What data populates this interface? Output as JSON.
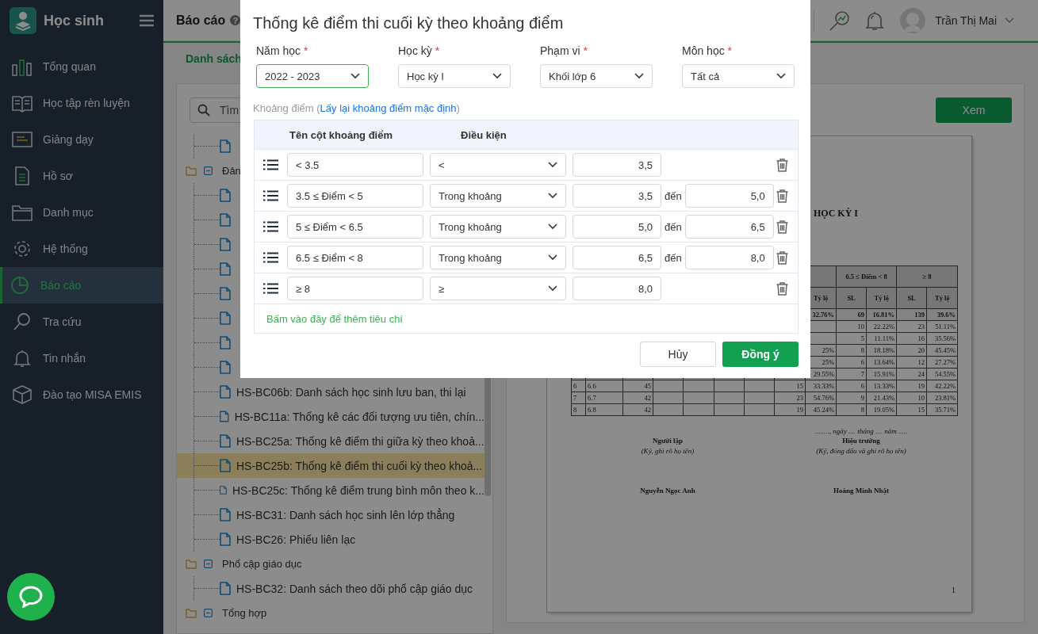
{
  "app": {
    "title": "Học sinh"
  },
  "sidebar": {
    "items": [
      {
        "label": "Tổng quan",
        "selected": false
      },
      {
        "label": "Học tập rèn luyện",
        "selected": false
      },
      {
        "label": "Giảng dạy",
        "selected": false
      },
      {
        "label": "Hồ sơ",
        "selected": false
      },
      {
        "label": "Danh mục",
        "selected": false
      },
      {
        "label": "Hệ thống",
        "selected": false
      },
      {
        "label": "Báo cáo",
        "selected": true
      },
      {
        "label": "Tra cứu",
        "selected": false
      },
      {
        "label": "Tin nhắn",
        "selected": false
      },
      {
        "label": "Đào tạo MISA EMIS",
        "selected": false
      }
    ]
  },
  "topbar": {
    "title": "Báo cáo",
    "help_glyph": "?",
    "user_name": "Trần Thị Mai"
  },
  "tabs": [
    {
      "label": "Danh sách",
      "selected": true
    }
  ],
  "report_tree": {
    "search": {
      "placeholder": "Tìm"
    },
    "nodes": [
      {
        "kind": "item",
        "selected": false
      },
      {
        "kind": "group",
        "label": "Đản",
        "expanded": true,
        "children": [
          {
            "kind": "item",
            "selected": false
          },
          {
            "kind": "item",
            "selected": false
          },
          {
            "kind": "item",
            "selected": false
          },
          {
            "kind": "item",
            "selected": false
          },
          {
            "kind": "item",
            "selected": false
          },
          {
            "kind": "item",
            "selected": false
          },
          {
            "kind": "item",
            "selected": false
          },
          {
            "kind": "item",
            "selected": false
          },
          {
            "kind": "item",
            "label": "HS-BC06b: Danh sách học sinh lưu ban, thi lại",
            "selected": false
          },
          {
            "kind": "item",
            "label": "HS-BC11a: Thống kê các đối tượng ưu tiên, chín...",
            "selected": false
          },
          {
            "kind": "item",
            "label": "HS-BC25a: Thống kê điểm thi giữa kỳ theo khoả...",
            "selected": false
          },
          {
            "kind": "item",
            "label": "HS-BC25b: Thống kê điểm thi cuối kỳ theo khoả...",
            "selected": true
          },
          {
            "kind": "item",
            "label": "HS-BC25c: Thống kê điểm trung bình môn theo k...",
            "selected": false
          },
          {
            "kind": "item",
            "label": "HS-BC31: Danh sách học sinh lên lớp thẳng",
            "selected": false
          },
          {
            "kind": "item",
            "label": "HS-BC26: Phiếu liên lạc",
            "selected": false
          }
        ]
      },
      {
        "kind": "group",
        "label": "Phổ cập giáo dục",
        "expanded": true,
        "children": [
          {
            "kind": "item",
            "label": "HS-BC32: Danh sách theo dõi phổ cập giáo dục",
            "selected": false
          }
        ]
      },
      {
        "kind": "group",
        "label": "Tổng hợp",
        "expanded": true
      }
    ]
  },
  "preview": {
    "view_button": "Xem",
    "document": {
      "title": "HỌC KỲ I",
      "header_groups": [
        "6.5 ≤ Điểm < 8",
        "≥ 8"
      ],
      "subheaders": [
        "Tỷ lệ",
        "SL",
        "Tỷ lệ",
        "SL",
        "Tỷ lệ"
      ],
      "rows": [
        {
          "kind": "total",
          "cells": [
            null,
            null,
            null,
            null,
            null,
            null,
            null,
            null,
            "32.76%",
            "69",
            "16.81%",
            "139",
            "39.6%"
          ]
        },
        {
          "kind": "class",
          "cells": [
            null,
            null,
            null,
            null,
            null,
            null,
            null,
            null,
            null,
            "10",
            "22.22%",
            "23",
            "51.11%"
          ]
        },
        {
          "kind": "class",
          "cells": [
            null,
            null,
            null,
            null,
            null,
            null,
            null,
            null,
            null,
            "5",
            "11.11%",
            "16",
            "35.56%"
          ]
        },
        {
          "kind": "class",
          "cells": [
            null,
            null,
            null,
            null,
            null,
            null,
            null,
            null,
            "25%",
            "8",
            "18.18%",
            "20",
            "45.45%"
          ]
        },
        {
          "kind": "class",
          "cells": [
            null,
            null,
            null,
            null,
            null,
            null,
            null,
            null,
            "25%",
            "6",
            "13.64%",
            "12",
            "27.27%"
          ]
        },
        {
          "kind": "class",
          "cells": [
            null,
            null,
            null,
            null,
            null,
            null,
            null,
            null,
            "29.55%",
            "7",
            "15.91%",
            "24",
            "54.55%"
          ]
        },
        {
          "kind": "class",
          "cells": [
            "6",
            "6.6",
            "45",
            null,
            null,
            null,
            null,
            "15",
            "33.33%",
            "6",
            "13.33%",
            "19",
            "42.22%"
          ]
        },
        {
          "kind": "class",
          "cells": [
            "7",
            "6.7",
            "42",
            null,
            null,
            null,
            null,
            "23",
            "54.76%",
            "9",
            "21.43%",
            "10",
            "23.81%"
          ]
        },
        {
          "kind": "class",
          "cells": [
            "8",
            "6.8",
            "42",
            null,
            null,
            null,
            null,
            "19",
            "45.24%",
            "8",
            "19.05%",
            "15",
            "35.71%"
          ]
        }
      ],
      "signers": [
        {
          "role": "Người lập",
          "hint": "(Ký, ghi rõ họ tên)",
          "name": "Nguyễn Ngọc Anh"
        },
        {
          "date": "........, ngày .... tháng .... năm .....",
          "role": "Hiệu trưởng",
          "hint": "(Ký, đóng dấu và ghi rõ họ tên)",
          "name": "Hoàng Minh Nhật"
        }
      ],
      "page_number": "1"
    }
  },
  "dialog": {
    "title": "Thống kê điểm thi cuối kỳ theo khoảng điểm",
    "filters": [
      {
        "label": "Năm học",
        "required_mark": "*",
        "value": "2022 - 2023",
        "focused": true
      },
      {
        "label": "Học kỳ",
        "required_mark": "*",
        "value": "Học kỳ I",
        "focused": false
      },
      {
        "label": "Phạm vi",
        "required_mark": "*",
        "value": "Khối lớp 6",
        "focused": false
      },
      {
        "label": "Môn học",
        "required_mark": "*",
        "value": "Tất cả",
        "focused": false
      }
    ],
    "range_note": {
      "before": "Khoảng điểm (",
      "link": "Lấy lại khoảng điểm mặc định",
      "after": ")"
    },
    "columns": [
      "Tên cột khoảng điểm",
      "Điều kiện"
    ],
    "ranges": [
      {
        "kind": "single",
        "name": "< 3.5",
        "condition": "<",
        "from": "3,5"
      },
      {
        "kind": "between",
        "name": "3.5 ≤ Điểm < 5",
        "condition": "Trong khoảng",
        "from": "3,5",
        "to_label": "đến",
        "to": "5,0"
      },
      {
        "kind": "between",
        "name": "5 ≤ Điểm < 6.5",
        "condition": "Trong khoảng",
        "from": "5,0",
        "to_label": "đến",
        "to": "6,5"
      },
      {
        "kind": "between",
        "name": "6.5 ≤ Điểm < 8",
        "condition": "Trong khoảng",
        "from": "6,5",
        "to_label": "đến",
        "to": "8,0"
      },
      {
        "kind": "single",
        "name": "≥ 8",
        "condition": "≥",
        "from": "8,0"
      }
    ],
    "add_link": "Bấm vào đây để thêm tiêu chí",
    "cancel_button": "Hủy",
    "confirm_button": "Đồng ý"
  }
}
